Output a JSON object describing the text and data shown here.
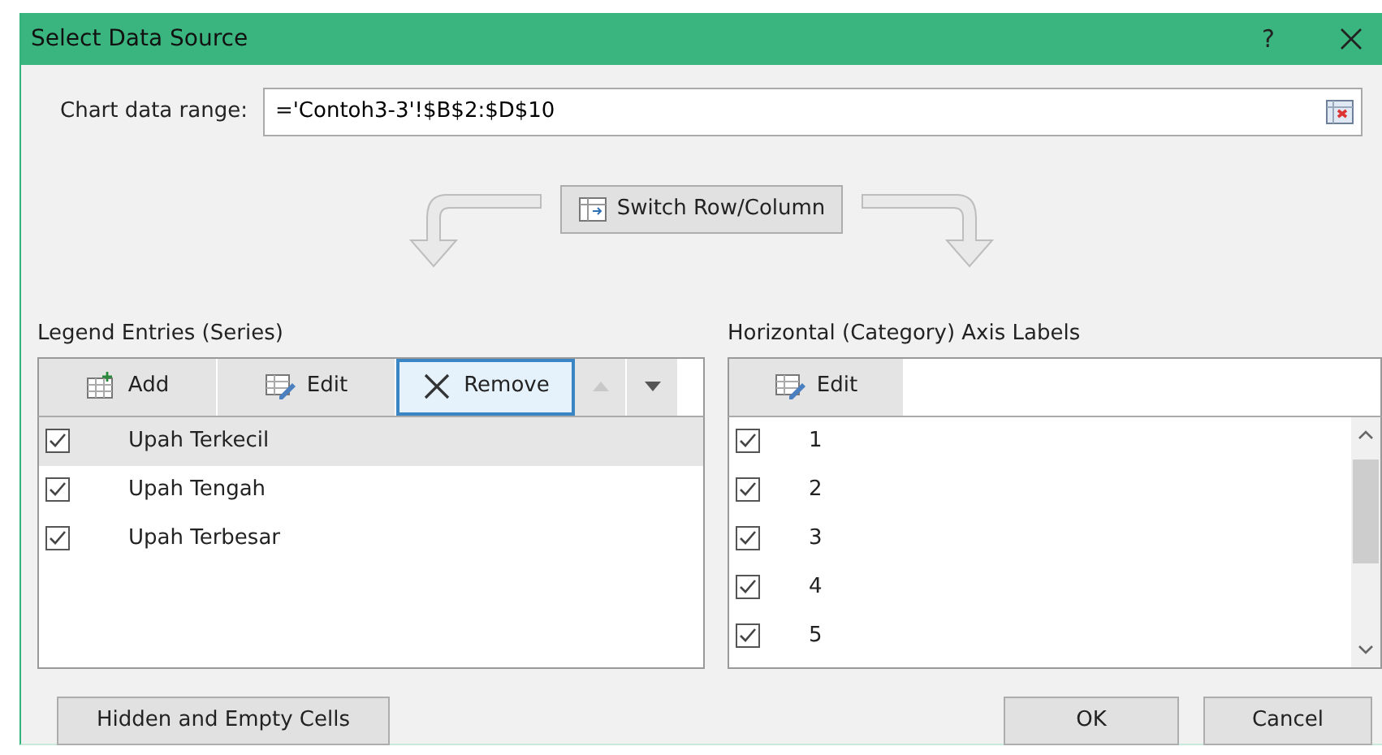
{
  "window": {
    "title": "Select Data Source",
    "help": "?"
  },
  "chart_data_range": {
    "label": "Chart data range:",
    "value": "='Contoh3-3'!$B$2:$D$10"
  },
  "switch_button": {
    "label": "Switch Row/Column"
  },
  "legend_entries": {
    "title": "Legend Entries (Series)",
    "buttons": [
      {
        "kind": "add",
        "label": "Add",
        "focused": false
      },
      {
        "kind": "edit",
        "label": "Edit",
        "focused": false
      },
      {
        "kind": "remove",
        "label": "Remove",
        "focused": true
      }
    ],
    "order_buttons": [
      {
        "kind": "up",
        "disabled": true
      },
      {
        "kind": "down",
        "disabled": false
      }
    ],
    "items": [
      {
        "label": "Upah Terkecil",
        "checked": true,
        "selected": true
      },
      {
        "label": "Upah Tengah",
        "checked": true,
        "selected": false
      },
      {
        "label": "Upah Terbesar",
        "checked": true,
        "selected": false
      }
    ]
  },
  "axis_labels": {
    "title": "Horizontal (Category) Axis Labels",
    "edit_button": {
      "label": "Edit"
    },
    "items": [
      {
        "label": "1",
        "checked": true
      },
      {
        "label": "2",
        "checked": true
      },
      {
        "label": "3",
        "checked": true
      },
      {
        "label": "4",
        "checked": true
      },
      {
        "label": "5",
        "checked": true
      }
    ]
  },
  "footer": {
    "hidden_button": "Hidden and Empty Cells",
    "ok_button": "OK",
    "cancel_button": "Cancel"
  }
}
